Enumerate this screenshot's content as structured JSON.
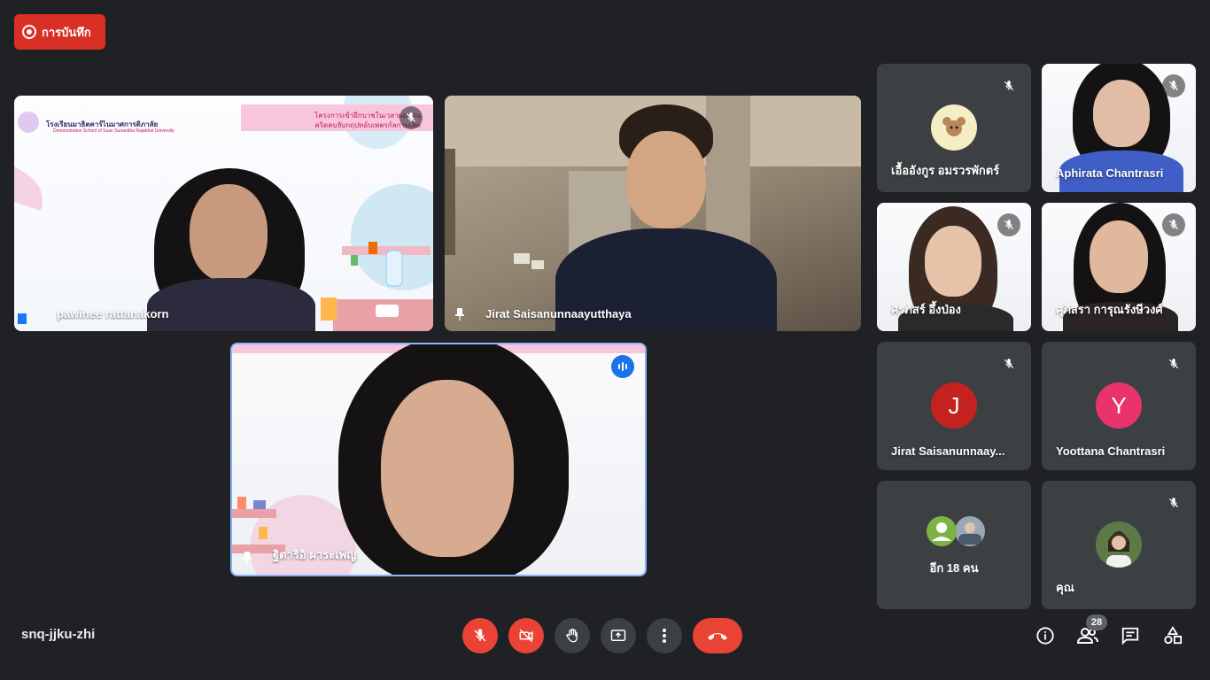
{
  "recording": {
    "label": "การบันทึก",
    "color": "#d93025"
  },
  "meeting": {
    "code": "snq-jjku-zhi"
  },
  "main_tiles": [
    {
      "name": "pawinee rattanakorn",
      "muted": true,
      "pinned": false
    },
    {
      "name": "Jirat Saisanunnaayutthaya",
      "muted": false,
      "pinned": false
    },
    {
      "name": "ฐิตาริอิ ผาระเพ็ญ",
      "muted": false,
      "speaking": true
    }
  ],
  "slide": {
    "school_name": "โรงเรียนมาธิตคาร์ไนมาศการติภาลัย",
    "school_sub": "Demonstration School of Suan Sunandha Rajabhat University",
    "banner_line1": "โครงการเข้าฝึกบวชในเวลาผอบหน",
    "banner_line2": "คริดคบจับกฤปทอ์บเพตรก์ลกามเลิต"
  },
  "side_tiles": [
    {
      "name": "เอื้ออังกูร อมรวรพักตร์",
      "type": "avatar-image",
      "muted": true
    },
    {
      "name": "Aphirata Chantrasri",
      "type": "video",
      "muted": true
    },
    {
      "name": "ศิรภัสร์ อึ้งป่อง",
      "type": "video",
      "muted": true
    },
    {
      "name": "ศุภิสรา การุณรังษีวงศ์",
      "type": "video",
      "muted": true
    },
    {
      "name": "Jirat Saisanunnaay...",
      "type": "initial",
      "initial": "J",
      "color": "#c5221f",
      "muted": true
    },
    {
      "name": "Yoottana Chantrasri",
      "type": "initial",
      "initial": "Y",
      "color": "#e8336d",
      "muted": true
    },
    {
      "name": "อีก 18 คน",
      "type": "others"
    },
    {
      "name": "คุณ",
      "type": "self",
      "muted": true
    }
  ],
  "controls": {
    "mic": "mic-off-icon",
    "camera": "camera-off-icon",
    "raise_hand": "hand-icon",
    "present": "present-icon",
    "more": "more-vert-icon",
    "end_call": "end-call-icon"
  },
  "right_controls": {
    "participants_count": "28",
    "icons": [
      "info-icon",
      "people-icon",
      "chat-icon",
      "activities-icon"
    ]
  }
}
